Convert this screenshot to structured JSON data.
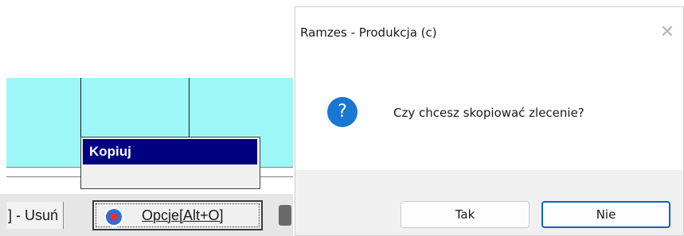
{
  "background_app": {
    "context_menu": {
      "items": [
        {
          "label": "Kopiuj",
          "selected": true
        }
      ]
    },
    "buttons": {
      "delete_label": "] - Usuń",
      "options_label": "Opcje[Alt+O]",
      "options_icon": "gear-icon"
    },
    "grid_color": "#9ef7f7",
    "selection_color": "#000080"
  },
  "dialog": {
    "title": "Ramzes - Produkcja (c)",
    "close_glyph": "✕",
    "icon": "question-icon",
    "icon_glyph": "?",
    "icon_color": "#1976d2",
    "message": "Czy chcesz skopiować zlecenie?",
    "buttons": {
      "yes_label": "Tak",
      "no_label": "Nie"
    },
    "accent_color": "#0067c0"
  }
}
